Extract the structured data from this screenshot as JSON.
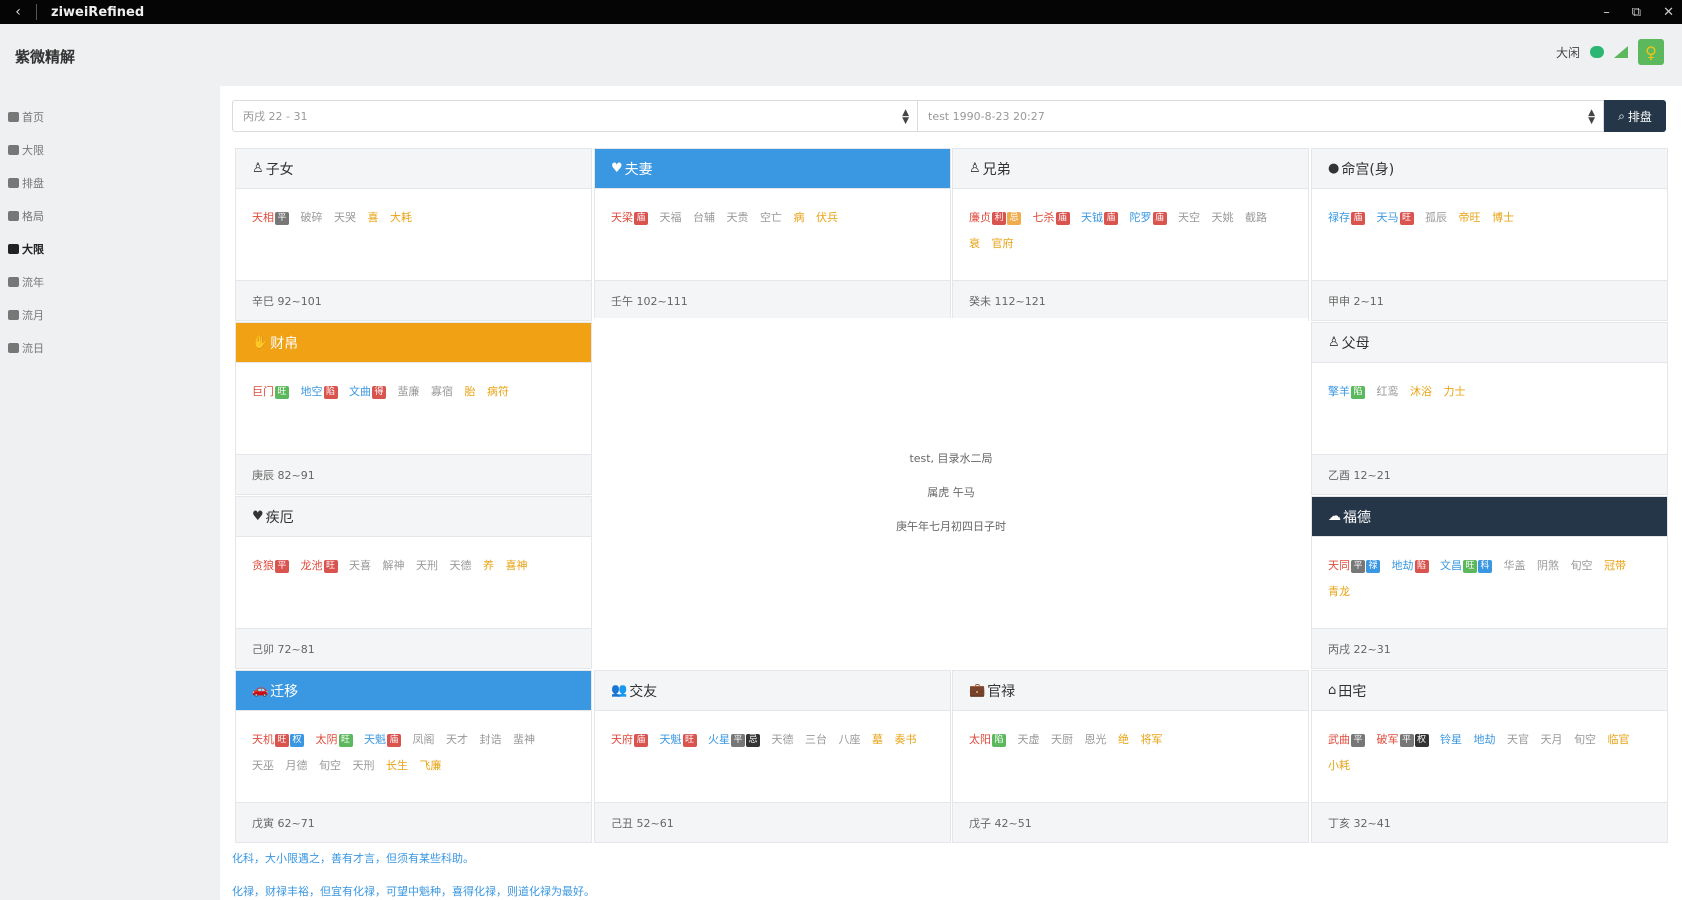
{
  "window": {
    "title": "ziweiRefined",
    "back": "‹",
    "minimize": "–",
    "restore": "⧉",
    "close": "✕"
  },
  "header": {
    "brand": "紫微精解",
    "user": "大闲"
  },
  "sidebar": {
    "items": [
      {
        "label": "首页",
        "active": false
      },
      {
        "label": "大限",
        "active": false
      },
      {
        "label": "排盘",
        "active": false
      },
      {
        "label": "格局",
        "active": false
      },
      {
        "label": "大限",
        "active": true
      },
      {
        "label": "流年",
        "active": false
      },
      {
        "label": "流月",
        "active": false
      },
      {
        "label": "流日",
        "active": false
      }
    ]
  },
  "toolbar": {
    "select1": "丙戌 22 - 31",
    "select2": "test 1990-8-23 20:27",
    "search_label": "排盘"
  },
  "palaces": {
    "zinu": {
      "name": "子女",
      "icon": "♙",
      "footer": "辛巳 92~101",
      "stars": [
        {
          "t": "天相",
          "c": "red",
          "badges": [
            {
              "t": "平",
              "c": "d"
            }
          ]
        },
        {
          "t": "破碎",
          "c": "gray"
        },
        {
          "t": "天哭",
          "c": "gray"
        },
        {
          "t": "喜",
          "c": "gold"
        },
        {
          "t": "大耗",
          "c": "gold"
        }
      ]
    },
    "fuqi": {
      "name": "夫妻",
      "icon": "♥",
      "footer": "壬午 102~111",
      "stars": [
        {
          "t": "天梁",
          "c": "red",
          "badges": [
            {
              "t": "庙",
              "c": "r"
            }
          ]
        },
        {
          "t": "天福",
          "c": "gray"
        },
        {
          "t": "台辅",
          "c": "gray"
        },
        {
          "t": "天贵",
          "c": "gray"
        },
        {
          "t": "空亡",
          "c": "gray"
        },
        {
          "t": "病",
          "c": "gold"
        },
        {
          "t": "伏兵",
          "c": "gold"
        }
      ]
    },
    "xiongdi": {
      "name": "兄弟",
      "icon": "♙",
      "footer": "癸未 112~121",
      "stars": [
        {
          "t": "廉贞",
          "c": "red",
          "badges": [
            {
              "t": "利",
              "c": "r"
            },
            {
              "t": "忌",
              "c": "o"
            }
          ]
        },
        {
          "t": "七杀",
          "c": "red",
          "badges": [
            {
              "t": "庙",
              "c": "r"
            }
          ]
        },
        {
          "t": "天钺",
          "c": "blue",
          "badges": [
            {
              "t": "庙",
              "c": "r"
            }
          ]
        },
        {
          "t": "陀罗",
          "c": "blue",
          "badges": [
            {
              "t": "庙",
              "c": "r"
            }
          ]
        },
        {
          "t": "天空",
          "c": "gray"
        },
        {
          "t": "天姚",
          "c": "gray"
        },
        {
          "t": "截路",
          "c": "gray"
        },
        {
          "t": "衰",
          "c": "gold"
        },
        {
          "t": "官府",
          "c": "gold"
        }
      ]
    },
    "minggong": {
      "name": "命宫(身)",
      "icon": "●",
      "footer": "甲申 2~11",
      "stars": [
        {
          "t": "禄存",
          "c": "blue",
          "badges": [
            {
              "t": "庙",
              "c": "r"
            }
          ]
        },
        {
          "t": "天马",
          "c": "blue",
          "badges": [
            {
              "t": "旺",
              "c": "r"
            }
          ]
        },
        {
          "t": "孤辰",
          "c": "gray"
        },
        {
          "t": "帝旺",
          "c": "gold"
        },
        {
          "t": "博士",
          "c": "gold"
        }
      ]
    },
    "caibo": {
      "name": "财帛",
      "icon": "✋",
      "footer": "庚辰 82~91",
      "stars": [
        {
          "t": "巨门",
          "c": "red",
          "badges": [
            {
              "t": "旺",
              "c": "g"
            }
          ]
        },
        {
          "t": "地空",
          "c": "blue",
          "badges": [
            {
              "t": "陷",
              "c": "r"
            }
          ]
        },
        {
          "t": "文曲",
          "c": "blue",
          "badges": [
            {
              "t": "得",
              "c": "r"
            }
          ]
        },
        {
          "t": "蜚廉",
          "c": "gray"
        },
        {
          "t": "寡宿",
          "c": "gray"
        },
        {
          "t": "胎",
          "c": "gold"
        },
        {
          "t": "病符",
          "c": "gold"
        }
      ]
    },
    "fumu": {
      "name": "父母",
      "icon": "♙",
      "footer": "乙酉 12~21",
      "stars": [
        {
          "t": "擎羊",
          "c": "blue",
          "badges": [
            {
              "t": "陷",
              "c": "g"
            }
          ]
        },
        {
          "t": "红鸾",
          "c": "gray"
        },
        {
          "t": "沐浴",
          "c": "gold"
        },
        {
          "t": "力士",
          "c": "gold"
        }
      ]
    },
    "jie": {
      "name": "疾厄",
      "icon": "♥",
      "footer": "己卯 72~81",
      "stars": [
        {
          "t": "贪狼",
          "c": "red",
          "badges": [
            {
              "t": "平",
              "c": "r"
            }
          ]
        },
        {
          "t": "龙池",
          "c": "red",
          "badges": [
            {
              "t": "旺",
              "c": "r"
            }
          ]
        },
        {
          "t": "天喜",
          "c": "gray"
        },
        {
          "t": "解神",
          "c": "gray"
        },
        {
          "t": "天刑",
          "c": "gray"
        },
        {
          "t": "天德",
          "c": "gray"
        },
        {
          "t": "养",
          "c": "gold"
        },
        {
          "t": "喜神",
          "c": "gold"
        }
      ]
    },
    "fude": {
      "name": "福德",
      "icon": "☁",
      "footer": "丙戌 22~31",
      "stars": [
        {
          "t": "天同",
          "c": "red",
          "badges": [
            {
              "t": "平",
              "c": "d"
            },
            {
              "t": "禄",
              "c": "b"
            }
          ]
        },
        {
          "t": "地劫",
          "c": "blue",
          "badges": [
            {
              "t": "陷",
              "c": "r"
            }
          ]
        },
        {
          "t": "文昌",
          "c": "blue",
          "badges": [
            {
              "t": "旺",
              "c": "g"
            },
            {
              "t": "科",
              "c": "b"
            }
          ]
        },
        {
          "t": "华盖",
          "c": "gray"
        },
        {
          "t": "阴煞",
          "c": "gray"
        },
        {
          "t": "旬空",
          "c": "gray"
        },
        {
          "t": "冠带",
          "c": "gold"
        },
        {
          "t": "青龙",
          "c": "gold"
        }
      ]
    },
    "qianyi": {
      "name": "迁移",
      "icon": "🚗",
      "footer": "戊寅 62~71",
      "stars": [
        {
          "t": "天机",
          "c": "red",
          "badges": [
            {
              "t": "旺",
              "c": "r"
            },
            {
              "t": "权",
              "c": "b"
            }
          ]
        },
        {
          "t": "太阴",
          "c": "red",
          "badges": [
            {
              "t": "旺",
              "c": "g"
            }
          ]
        },
        {
          "t": "天魁",
          "c": "blue",
          "badges": [
            {
              "t": "庙",
              "c": "r"
            }
          ]
        },
        {
          "t": "凤阁",
          "c": "gray"
        },
        {
          "t": "天才",
          "c": "gray"
        },
        {
          "t": "封诰",
          "c": "gray"
        },
        {
          "t": "蜚神",
          "c": "gray"
        },
        {
          "t": "天巫",
          "c": "gray"
        },
        {
          "t": "月德",
          "c": "gray"
        },
        {
          "t": "旬空",
          "c": "gray"
        },
        {
          "t": "天刑",
          "c": "gray"
        },
        {
          "t": "长生",
          "c": "gold"
        },
        {
          "t": "飞廉",
          "c": "gold"
        }
      ]
    },
    "jiaoyou": {
      "name": "交友",
      "icon": "👥",
      "footer": "己丑 52~61",
      "stars": [
        {
          "t": "天府",
          "c": "red",
          "badges": [
            {
              "t": "庙",
              "c": "r"
            }
          ]
        },
        {
          "t": "天魁",
          "c": "blue",
          "badges": [
            {
              "t": "旺",
              "c": "r"
            }
          ]
        },
        {
          "t": "火星",
          "c": "blue",
          "badges": [
            {
              "t": "平",
              "c": "d"
            },
            {
              "t": "忌",
              "c": "k"
            }
          ]
        },
        {
          "t": "天德",
          "c": "gray"
        },
        {
          "t": "三台",
          "c": "gray"
        },
        {
          "t": "八座",
          "c": "gray"
        },
        {
          "t": "墓",
          "c": "gold"
        },
        {
          "t": "奏书",
          "c": "gold"
        }
      ]
    },
    "guanlu": {
      "name": "官禄",
      "icon": "💼",
      "footer": "戊子 42~51",
      "stars": [
        {
          "t": "太阳",
          "c": "red",
          "badges": [
            {
              "t": "陷",
              "c": "g"
            }
          ]
        },
        {
          "t": "天虚",
          "c": "gray"
        },
        {
          "t": "天厨",
          "c": "gray"
        },
        {
          "t": "恩光",
          "c": "gray"
        },
        {
          "t": "绝",
          "c": "gold"
        },
        {
          "t": "将军",
          "c": "gold"
        }
      ]
    },
    "tianzhai": {
      "name": "田宅",
      "icon": "⌂",
      "footer": "丁亥 32~41",
      "stars": [
        {
          "t": "武曲",
          "c": "red",
          "badges": [
            {
              "t": "平",
              "c": "d"
            }
          ]
        },
        {
          "t": "破军",
          "c": "red",
          "badges": [
            {
              "t": "平",
              "c": "d"
            },
            {
              "t": "权",
              "c": "k"
            }
          ]
        },
        {
          "t": "铃星",
          "c": "blue"
        },
        {
          "t": "地劫",
          "c": "blue"
        },
        {
          "t": "天官",
          "c": "gray"
        },
        {
          "t": "天月",
          "c": "gray"
        },
        {
          "t": "旬空",
          "c": "gray"
        },
        {
          "t": "临官",
          "c": "gold"
        },
        {
          "t": "小耗",
          "c": "gold"
        }
      ]
    }
  },
  "center": {
    "line1": "test, 目录水二局",
    "line2": "属虎 午马",
    "line3": "庚午年七月初四日子时"
  },
  "notes": {
    "line1": "化科，大小限遇之，善有才言，但须有某些科助。",
    "line2": "化禄，财禄丰裕，但宜有化禄，可望中魁种，喜得化禄，则道化禄为最好。"
  },
  "colors": {
    "blue": "#3a97e2",
    "orange": "#f1a114",
    "navy": "#243648",
    "red": "#e04a3b",
    "gold": "#e8a314"
  }
}
